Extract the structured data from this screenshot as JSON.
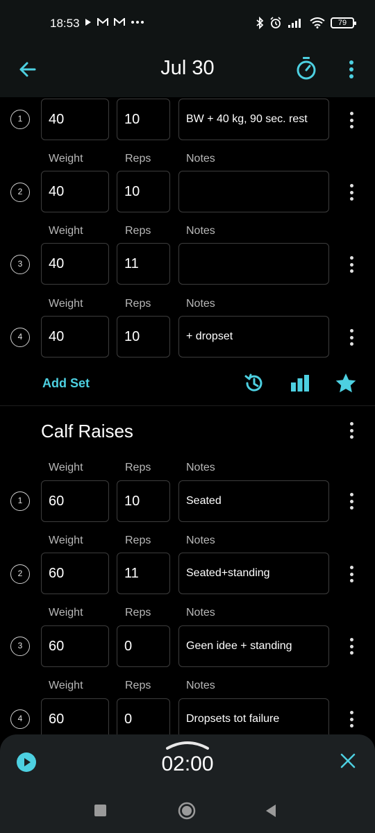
{
  "status_bar": {
    "time": "18:53",
    "battery": "79"
  },
  "app_bar": {
    "title": "Jul 30"
  },
  "exercise1": {
    "sets": [
      {
        "num": "1",
        "weight": "40",
        "reps": "10",
        "notes": "BW + 40 kg, 90 sec. rest"
      },
      {
        "num": "2",
        "weight": "40",
        "reps": "10",
        "notes": ""
      },
      {
        "num": "3",
        "weight": "40",
        "reps": "11",
        "notes": ""
      },
      {
        "num": "4",
        "weight": "40",
        "reps": "10",
        "notes": "+ dropset"
      }
    ],
    "add_set_label": "Add Set"
  },
  "labels": {
    "weight": "Weight",
    "reps": "Reps",
    "notes": "Notes"
  },
  "exercise2": {
    "title": "Calf Raises",
    "sets": [
      {
        "num": "1",
        "weight": "60",
        "reps": "10",
        "notes": "Seated"
      },
      {
        "num": "2",
        "weight": "60",
        "reps": "11",
        "notes": "Seated+standing"
      },
      {
        "num": "3",
        "weight": "60",
        "reps": "0",
        "notes": "Geen idee + standing"
      },
      {
        "num": "4",
        "weight": "60",
        "reps": "0",
        "notes": "Dropsets tot failure"
      }
    ]
  },
  "rest_timer": {
    "value": "02:00"
  },
  "colors": {
    "accent": "#4dd0e1",
    "background": "#000000",
    "bar": "#101414",
    "sheet": "#1c2022"
  }
}
